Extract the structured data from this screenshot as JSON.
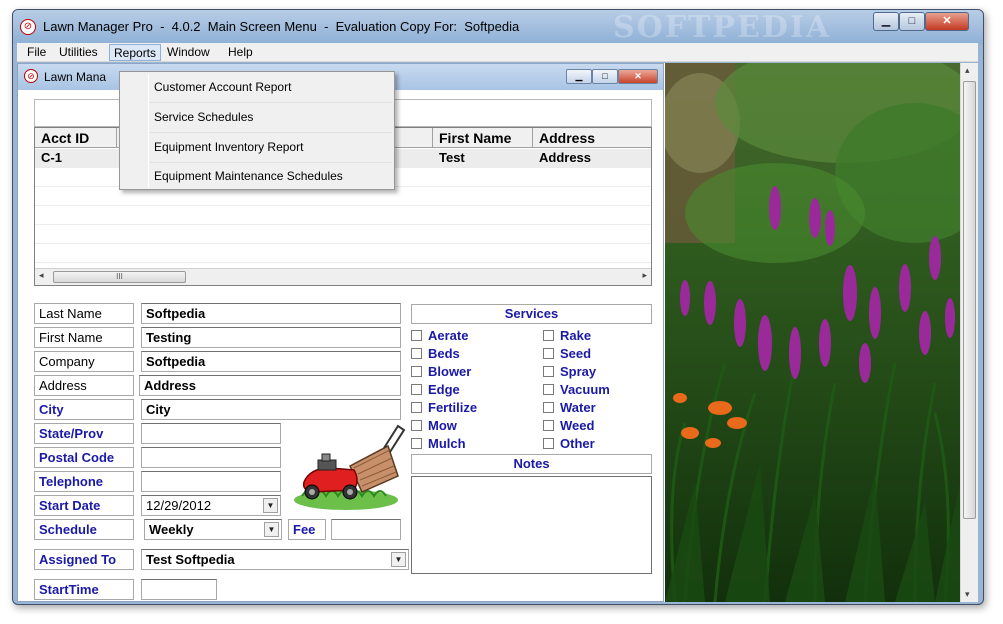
{
  "titlebar": {
    "title": "Lawn Manager Pro  -  4.0.2  Main Screen Menu  -  Evaluation Copy For:  Softpedia",
    "watermark": "SOFTPEDIA",
    "minimize": "▁",
    "maximize": "□",
    "close": "✕"
  },
  "menubar": {
    "items": [
      "File",
      "Utilities",
      "Reports",
      "Window",
      "Help"
    ]
  },
  "reports_menu": {
    "items": [
      "Customer Account Report",
      "Service Schedules",
      "Equipment Inventory Report",
      "Equipment Maintenance Schedules"
    ]
  },
  "child_window": {
    "title": "Lawn Mana",
    "banner_title_fragment": "a"
  },
  "grid": {
    "columns": [
      "Acct ID",
      "",
      "e",
      "First Name",
      "Address"
    ],
    "rows": [
      [
        "C-1",
        "",
        "n",
        "Test",
        "Address"
      ]
    ],
    "scroll_thumb": "III",
    "scroll_left": "◂",
    "scroll_right": "▸"
  },
  "form": {
    "last_name_label": "Last Name",
    "last_name": "Softpedia",
    "first_name_label": "First Name",
    "first_name": "Testing",
    "company_label": "Company",
    "company": "Softpedia",
    "address_label": "Address",
    "address": "Address",
    "city_label": "City",
    "city": "City",
    "state_label": "State/Prov",
    "state": "",
    "postal_label": "Postal Code",
    "postal": "",
    "telephone_label": "Telephone",
    "telephone": "",
    "start_date_label": "Start Date",
    "start_date": "12/29/2012",
    "schedule_label": "Schedule",
    "schedule": "Weekly",
    "fee_label": "Fee",
    "fee": "",
    "assigned_label": "Assigned To",
    "assigned": "Test Softpedia",
    "starttime_label": "StartTime",
    "starttime": "",
    "dropdown_arrow": "▼"
  },
  "services": {
    "title": "Services",
    "left": [
      "Aerate",
      "Beds",
      "Blower",
      "Edge",
      "Fertilize",
      "Mow",
      "Mulch"
    ],
    "right": [
      "Rake",
      "Seed",
      "Spray",
      "Vacuum",
      "Water",
      "Weed",
      "Other"
    ]
  },
  "notes": {
    "title": "Notes"
  },
  "scrollbar": {
    "up": "▴",
    "down": "▾"
  }
}
